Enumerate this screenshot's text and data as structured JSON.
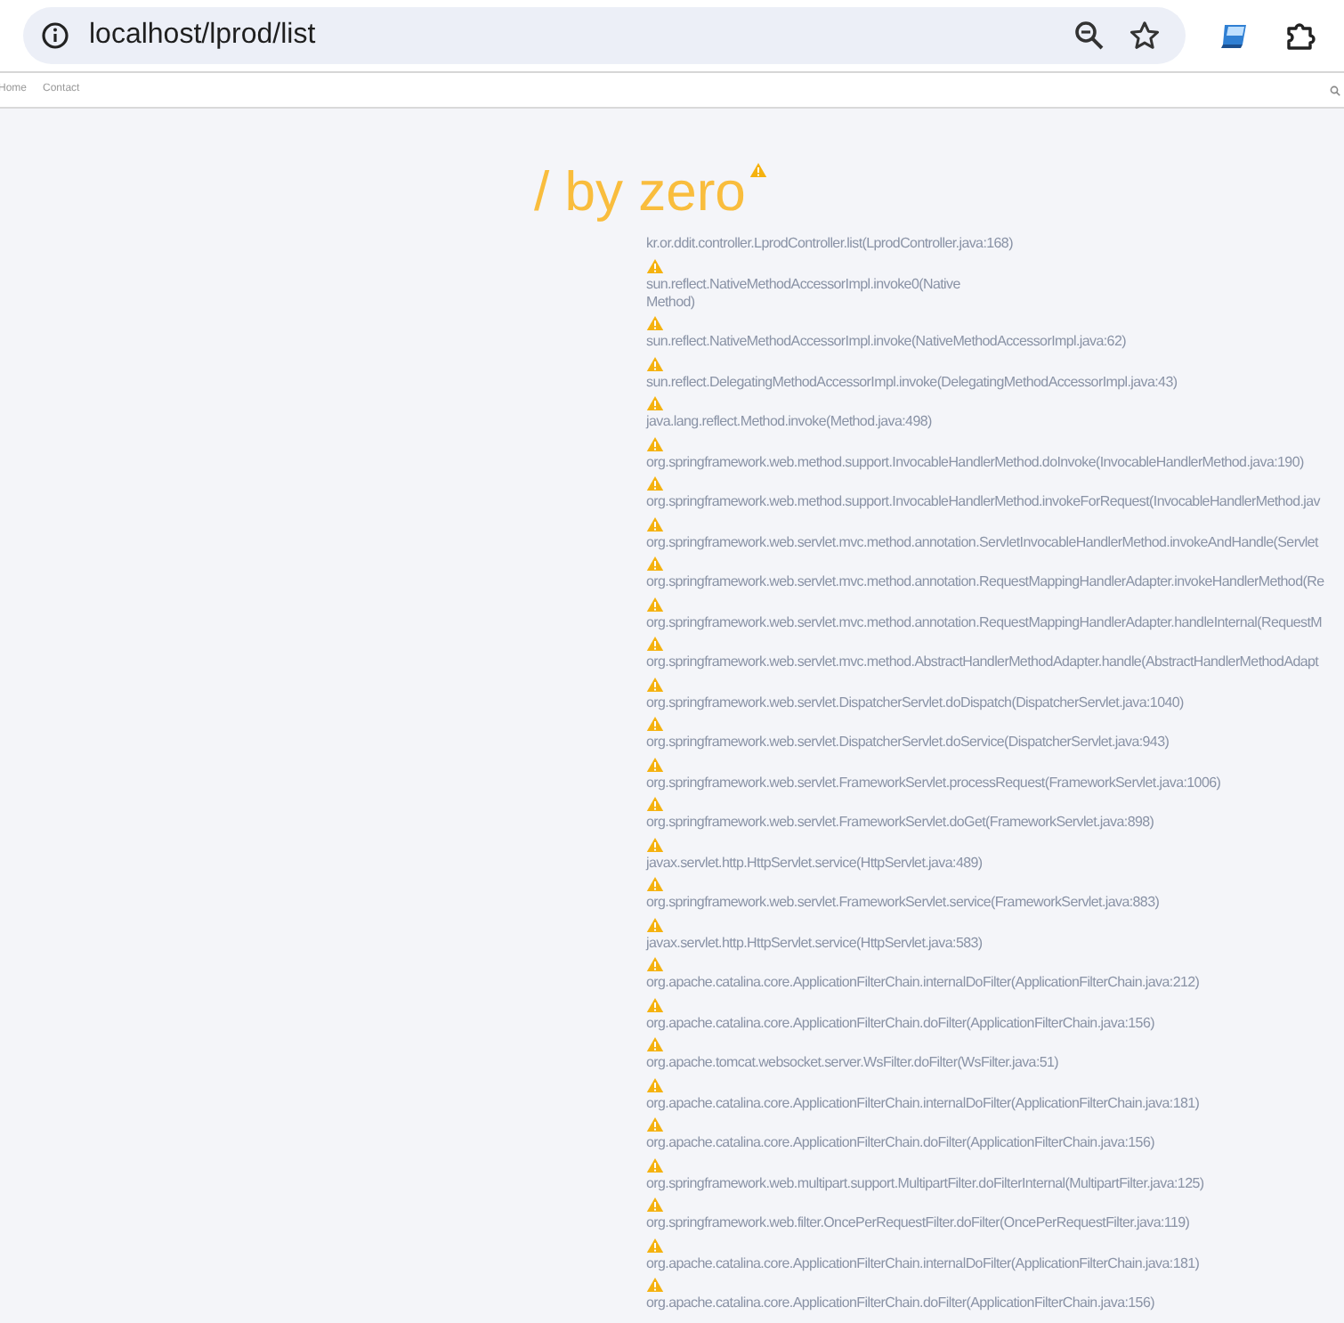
{
  "browser": {
    "url": "localhost/lprod/list"
  },
  "navbar": {
    "links": [
      "Home",
      "Contact"
    ]
  },
  "error": {
    "message": "/ by zero",
    "frames": [
      "kr.or.ddit.controller.LprodController.list(LprodController.java:168)",
      "sun.reflect.NativeMethodAccessorImpl.invoke0(Native\nMethod)",
      "sun.reflect.NativeMethodAccessorImpl.invoke(NativeMethodAccessorImpl.java:62)",
      "sun.reflect.DelegatingMethodAccessorImpl.invoke(DelegatingMethodAccessorImpl.java:43)",
      "java.lang.reflect.Method.invoke(Method.java:498)",
      "org.springframework.web.method.support.InvocableHandlerMethod.doInvoke(InvocableHandlerMethod.java:190)",
      "org.springframework.web.method.support.InvocableHandlerMethod.invokeForRequest(InvocableHandlerMethod.jav",
      "org.springframework.web.servlet.mvc.method.annotation.ServletInvocableHandlerMethod.invokeAndHandle(Servlet",
      "org.springframework.web.servlet.mvc.method.annotation.RequestMappingHandlerAdapter.invokeHandlerMethod(Re",
      "org.springframework.web.servlet.mvc.method.annotation.RequestMappingHandlerAdapter.handleInternal(RequestM",
      "org.springframework.web.servlet.mvc.method.AbstractHandlerMethodAdapter.handle(AbstractHandlerMethodAdapt",
      "org.springframework.web.servlet.DispatcherServlet.doDispatch(DispatcherServlet.java:1040)",
      "org.springframework.web.servlet.DispatcherServlet.doService(DispatcherServlet.java:943)",
      "org.springframework.web.servlet.FrameworkServlet.processRequest(FrameworkServlet.java:1006)",
      "org.springframework.web.servlet.FrameworkServlet.doGet(FrameworkServlet.java:898)",
      "javax.servlet.http.HttpServlet.service(HttpServlet.java:489)",
      "org.springframework.web.servlet.FrameworkServlet.service(FrameworkServlet.java:883)",
      "javax.servlet.http.HttpServlet.service(HttpServlet.java:583)",
      "org.apache.catalina.core.ApplicationFilterChain.internalDoFilter(ApplicationFilterChain.java:212)",
      "org.apache.catalina.core.ApplicationFilterChain.doFilter(ApplicationFilterChain.java:156)",
      "org.apache.tomcat.websocket.server.WsFilter.doFilter(WsFilter.java:51)",
      "org.apache.catalina.core.ApplicationFilterChain.internalDoFilter(ApplicationFilterChain.java:181)",
      "org.apache.catalina.core.ApplicationFilterChain.doFilter(ApplicationFilterChain.java:156)",
      "org.springframework.web.multipart.support.MultipartFilter.doFilterInternal(MultipartFilter.java:125)",
      "org.springframework.web.filter.OncePerRequestFilter.doFilter(OncePerRequestFilter.java:119)",
      "org.apache.catalina.core.ApplicationFilterChain.internalDoFilter(ApplicationFilterChain.java:181)",
      "org.apache.catalina.core.ApplicationFilterChain.doFilter(ApplicationFilterChain.java:156)"
    ]
  }
}
